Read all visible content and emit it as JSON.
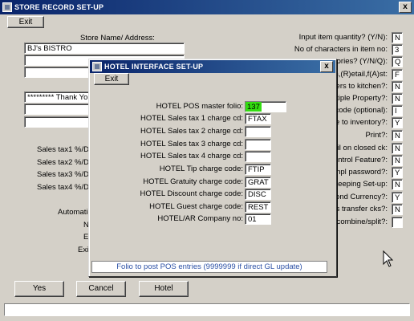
{
  "window": {
    "title": "STORE RECORD SET-UP",
    "exit_label": "Exit",
    "close_glyph": "x"
  },
  "store": {
    "name_label": "Store Name/ Address:",
    "name_value": "BJ's BISTRO",
    "message_value": "********* Thank You *"
  },
  "left_labels": {
    "tax1": "Sales tax1 %/De",
    "tax2": "Sales tax2 %/De",
    "tax3": "Sales tax3 %/De",
    "tax4": "Sales tax4 %/De",
    "automatic": "Automatic",
    "n": "N",
    "e": "E",
    "exi": "Exi"
  },
  "right_settings": [
    {
      "label": "Input item quantity? (Y/N):",
      "value": "N"
    },
    {
      "label": "No of characters in item no:",
      "value": "3"
    },
    {
      "label": "categories? (Y/N/Q):",
      "value": "Q"
    },
    {
      "label": "e dn,(R)etail,f(A)st:",
      "value": "F"
    },
    {
      "label": "orders to kitchen?:",
      "value": "N"
    },
    {
      "label": "Multiple Property?:",
      "value": "N"
    },
    {
      "label": "cial code (optional):",
      "value": "I"
    },
    {
      "label": "pdate to inventory?:",
      "value": "Y"
    },
    {
      "label": "Print?:",
      "value": "N"
    },
    {
      "label": "detail on closed ck:",
      "value": "N"
    },
    {
      "label": "h Control Feature?:",
      "value": "N"
    },
    {
      "label": "ny empl password?:",
      "value": "Y"
    },
    {
      "label": "imekeeping Set-up:",
      "value": "N"
    },
    {
      "label": "Second Currency?:",
      "value": "Y"
    },
    {
      "label": "ervers transfer cks?:",
      "value": "N"
    },
    {
      "label": "d to combine/split?:",
      "value": ""
    }
  ],
  "bottom_buttons": {
    "yes": "Yes",
    "cancel": "Cancel",
    "hotel": "Hotel"
  },
  "dialog": {
    "title": "HOTEL INTERFACE SET-UP",
    "exit_label": "Exit",
    "close_glyph": "x",
    "rows": [
      {
        "label": "HOTEL POS master folio:",
        "value": "137"
      },
      {
        "label": "HOTEL Sales tax 1 charge cd:",
        "value": "FTAX"
      },
      {
        "label": "HOTEL Sales tax 2 charge cd:",
        "value": ""
      },
      {
        "label": "HOTEL Sales tax 3 charge cd:",
        "value": ""
      },
      {
        "label": "HOTEL Sales tax 4 charge cd:",
        "value": ""
      },
      {
        "label": "HOTEL Tip charge code:",
        "value": "FTIP"
      },
      {
        "label": "HOTEL Gratuity charge code:",
        "value": "GRAT"
      },
      {
        "label": "HOTEL Discount charge code:",
        "value": "DISC"
      },
      {
        "label": "HOTEL Guest charge code:",
        "value": "REST"
      },
      {
        "label": "HOTEL/AR Company no:",
        "value": "01"
      }
    ],
    "hint": "Folio to post POS entries (9999999 if direct GL update)"
  }
}
